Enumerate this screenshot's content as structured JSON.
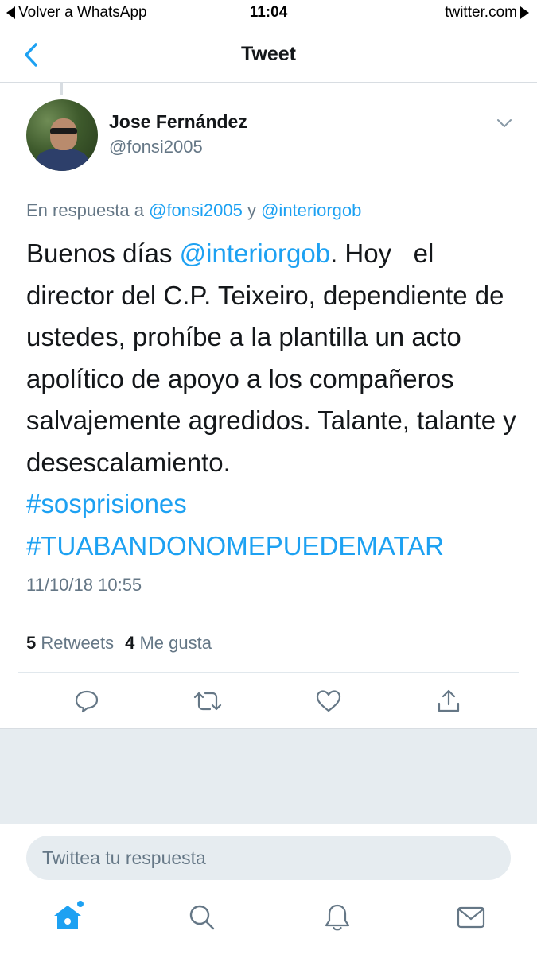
{
  "status_bar": {
    "back_app": "Volver a WhatsApp",
    "time": "11:04",
    "url": "twitter.com"
  },
  "nav": {
    "title": "Tweet",
    "back_icon": "chevron-left-icon"
  },
  "tweet": {
    "author_name": "Jose Fernández",
    "author_handle": "@fonsi2005",
    "reply_prefix": "En respuesta a ",
    "reply_user1": "@fonsi2005",
    "reply_and": " y ",
    "reply_user2": "@interiorgob",
    "text_1": "Buenos días ",
    "mention": "@interiorgob",
    "text_2": ". Hoy   el director del C.P. Teixeiro, dependiente de ustedes, prohíbe a la plantilla un acto apolítico de apoyo a los compañeros salvajemente agredidos. Talante, talante y desescalamiento.",
    "hashtag1": "#sosprisiones",
    "hashtag2": "#TUABANDONOMEPUEDEMATAR",
    "date": "11/10/18 10:55"
  },
  "stats": {
    "retweets_count": "5",
    "retweets_label": "Retweets",
    "likes_count": "4",
    "likes_label": "Me gusta"
  },
  "actions": [
    "reply-icon",
    "retweet-icon",
    "like-icon",
    "share-icon"
  ],
  "reply_box": {
    "placeholder": "Twittea tu respuesta"
  },
  "tabs": [
    "home-icon",
    "search-icon",
    "notifications-icon",
    "messages-icon"
  ],
  "colors": {
    "accent": "#1da1f2",
    "text": "#14171a",
    "muted": "#657786",
    "background_gray": "#e6ecf0"
  }
}
